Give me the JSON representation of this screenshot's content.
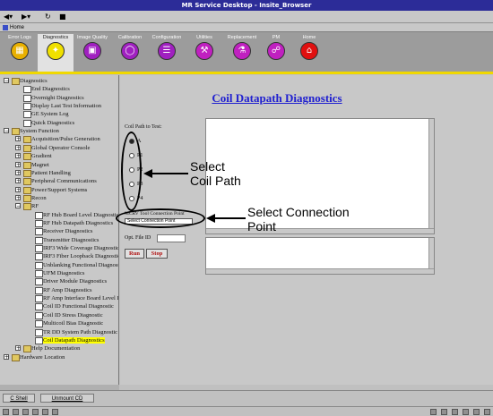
{
  "window": {
    "title": "MR Service Desktop - Insite_Browser"
  },
  "homebar": {
    "label": "Home"
  },
  "tabs": [
    {
      "label": "Error Logs",
      "icon": "error-logs-icon",
      "color": "#e8b000"
    },
    {
      "label": "Diagnostics",
      "icon": "diagnostics-icon",
      "color": "#f0e000",
      "active": true
    },
    {
      "label": "Image Quality",
      "icon": "image-quality-icon",
      "color": "#a020c0"
    },
    {
      "label": "Calibration",
      "icon": "calibration-icon",
      "color": "#a020c0"
    },
    {
      "label": "Configuration",
      "icon": "configuration-icon",
      "color": "#a020c0"
    },
    {
      "label": "Utilities",
      "icon": "utilities-icon",
      "color": "#c020c0"
    },
    {
      "label": "Replacement",
      "icon": "replacement-icon",
      "color": "#c020c0"
    },
    {
      "label": "PM",
      "icon": "pm-icon",
      "color": "#c020c0"
    },
    {
      "label": "Home",
      "icon": "home-icon",
      "color": "#e01010"
    }
  ],
  "tree": [
    "Diagnostics",
    "End Diagnostics",
    "Overnight Diagnostics",
    "Display Last Test Information",
    "GE System Log",
    "Quick Diagnostics",
    "System Function",
    "Acquisition/Pulse Generation",
    "Global Operator Console",
    "Gradient",
    "Magnet",
    "Patient Handling",
    "Peripheral Communications",
    "Power/Support Systems",
    "Recon",
    "RF",
    "RF Hub Board Level Diagnostic",
    "RF Hub Datapath Diagnostics",
    "Receiver Diagnostics",
    "Transmitter Diagnostics",
    "IRF3 Wide Coverage Diagnostic",
    "IRF3 Fiber Loopback Diagnostics",
    "Unblanking Functional Diagnostic",
    "UFM Diagnostics",
    "Driver Module Diagnostics",
    "RF Amp Diagnostics",
    "RF Amp Interface Board Level D",
    "Coil ID Functional Diagnostic",
    "Coil ID Stress Diagnostic",
    "Multicoil Bias Diagnostic",
    "TR DD System Path Diagnostic",
    "Coil Datapath Diagnostics",
    "Help Documentation",
    "Hardware Location"
  ],
  "content": {
    "title": "Coil Datapath Diagnostics",
    "coil_path_label": "Coil Path to Test:",
    "radio_options": [
      "A",
      "P1",
      "P2",
      "P3",
      "P4"
    ],
    "connection_label": "MCRV Tool Connection Point",
    "connection_selected": "Select Connection Point",
    "opt_file_label": "Opt. File ID",
    "run_label": "Run",
    "stop_label": "Stop"
  },
  "annotations": {
    "coil_path": "Select\nCoil Path",
    "connection_point": "Select Connection\nPoint"
  },
  "bottom": {
    "cshell": "C Shell",
    "unmount": "Unmount CD"
  }
}
